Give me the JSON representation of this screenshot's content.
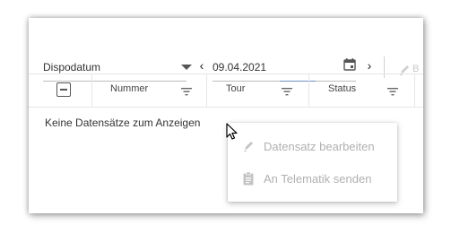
{
  "toolbar": {
    "date_type_select": "Dispodatum",
    "date_value": "09.04.2021",
    "prev_label": "‹",
    "next_label": "›",
    "edit_tool_label": "B"
  },
  "grid": {
    "columns": [
      {
        "label": "Nummer"
      },
      {
        "label": "Tour"
      },
      {
        "label": "Status"
      }
    ],
    "empty_message": "Keine Datensätze zum Anzeigen"
  },
  "context_menu": {
    "items": [
      {
        "label": "Datensatz bearbeiten",
        "icon": "pencil-icon",
        "enabled": false
      },
      {
        "label": "An Telematik senden",
        "icon": "clipboard-icon",
        "enabled": false
      }
    ]
  },
  "colors": {
    "disabled_text": "#b0b0b0",
    "accent_underline": "#6e8fc7"
  }
}
